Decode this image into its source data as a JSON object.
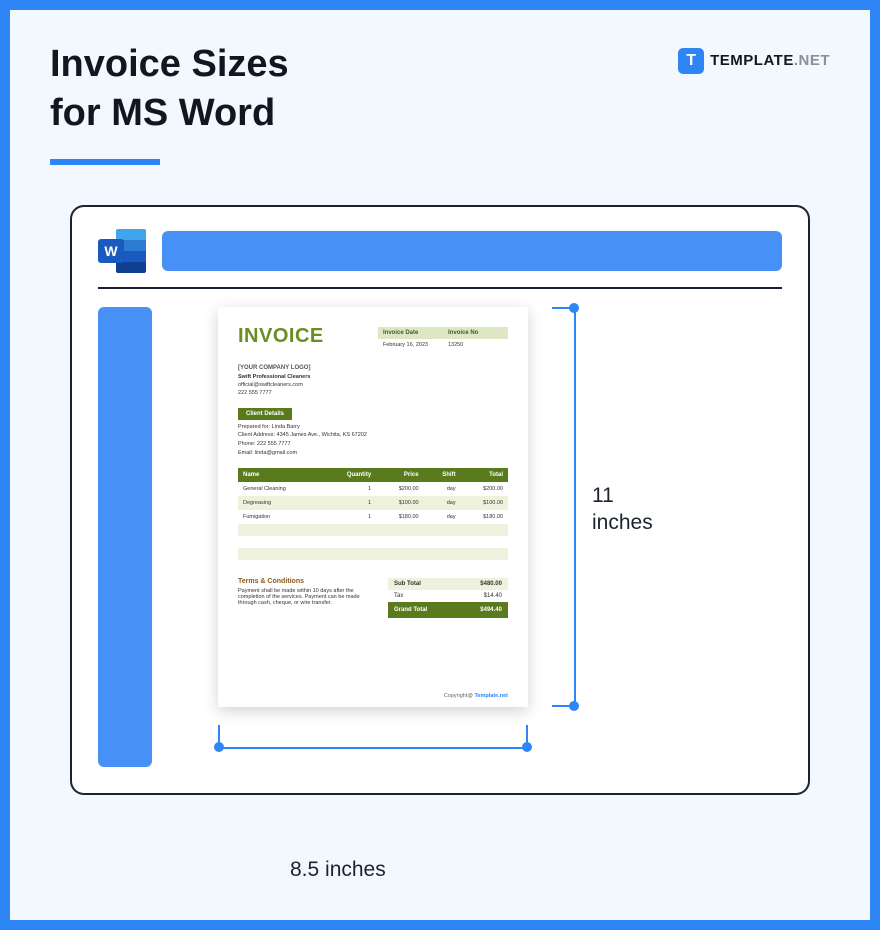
{
  "header": {
    "title_line1": "Invoice Sizes",
    "title_line2": "for MS Word",
    "brand_icon_letter": "T",
    "brand_text": "TEMPLATE",
    "brand_suffix": ".NET"
  },
  "word_icon_letter": "W",
  "dimensions": {
    "height_label": "11\ninches",
    "width_label": "8.5 inches"
  },
  "invoice": {
    "title": "INVOICE",
    "meta": {
      "head_date": "Invoice Date",
      "head_no": "Invoice No",
      "date": "February 16, 2023",
      "no": "13250"
    },
    "company": {
      "logo": "[YOUR COMPANY LOGO]",
      "name": "Swift Professional Cleaners",
      "email": "official@swiftcleaners.com",
      "phone": "222 555 7777"
    },
    "client_header": "Client Details",
    "client": {
      "prepared": "Prepared for: Linda Barry",
      "address": "Client Address: 4345 James Ave., Wichita, KS 67202",
      "phone": "Phone: 222 555 7777",
      "email": "Email: linda@gmail.com"
    },
    "columns": [
      "Name",
      "Quantity",
      "Price",
      "Shift",
      "Total"
    ],
    "rows": [
      {
        "name": "General Cleaning",
        "qty": "1",
        "price": "$200.00",
        "shift": "day",
        "total": "$200.00"
      },
      {
        "name": "Degreasing",
        "qty": "1",
        "price": "$100.00",
        "shift": "day",
        "total": "$100.00"
      },
      {
        "name": "Fumigation",
        "qty": "1",
        "price": "$180.00",
        "shift": "day",
        "total": "$180.00"
      }
    ],
    "terms": {
      "title": "Terms & Conditions",
      "text": "Payment shall be made within 10 days after the completion of the services. Payment can be made through cash, cheque, or wire transfer."
    },
    "totals": {
      "sub_label": "Sub Total",
      "sub_val": "$480.00",
      "tax_label": "Tax",
      "tax_val": "$14.40",
      "grand_label": "Grand Total",
      "grand_val": "$494.40"
    },
    "copyright_prefix": "Copyright@ ",
    "copyright_link": "Template.net"
  }
}
